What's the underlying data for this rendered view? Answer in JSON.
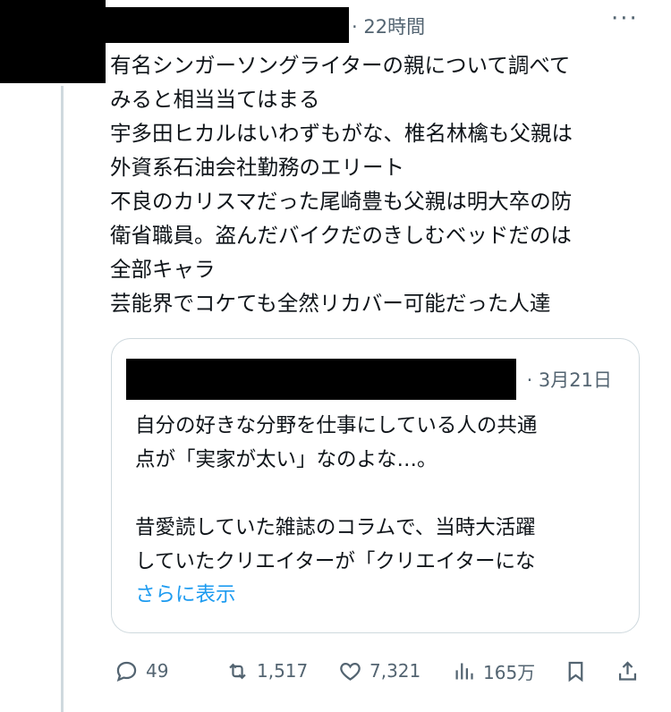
{
  "post": {
    "time": "· 22時間",
    "more_label": "···",
    "text_lines": [
      "有名シンガーソングライターの親について調べて",
      "みると相当当てはまる",
      "宇多田ヒカルはいわずもがな、椎名林檎も父親は",
      "外資系石油会社勤務のエリート",
      "不良のカリスマだった尾崎豊も父親は明大卒の防",
      "衛省職員。盗んだバイクだのきしむベッドだのは",
      "全部キャラ",
      "芸能界でコケても全然リカバー可能だった人達"
    ]
  },
  "quote": {
    "time": "· 3月21日",
    "para1_lines": [
      "自分の好きな分野を仕事にしている人の共通",
      "点が「実家が太い」なのよな…。"
    ],
    "para2_lines": [
      "昔愛読していた雑誌のコラムで、当時大活躍",
      "していたクリエイターが「クリエイターにな"
    ],
    "show_more": "さらに表示"
  },
  "actions": {
    "replies": "49",
    "reposts": "1,517",
    "likes": "7,321",
    "views": "165万"
  },
  "colors": {
    "accent": "#1d9bf0",
    "muted": "#536471",
    "border": "#cfd9de"
  }
}
